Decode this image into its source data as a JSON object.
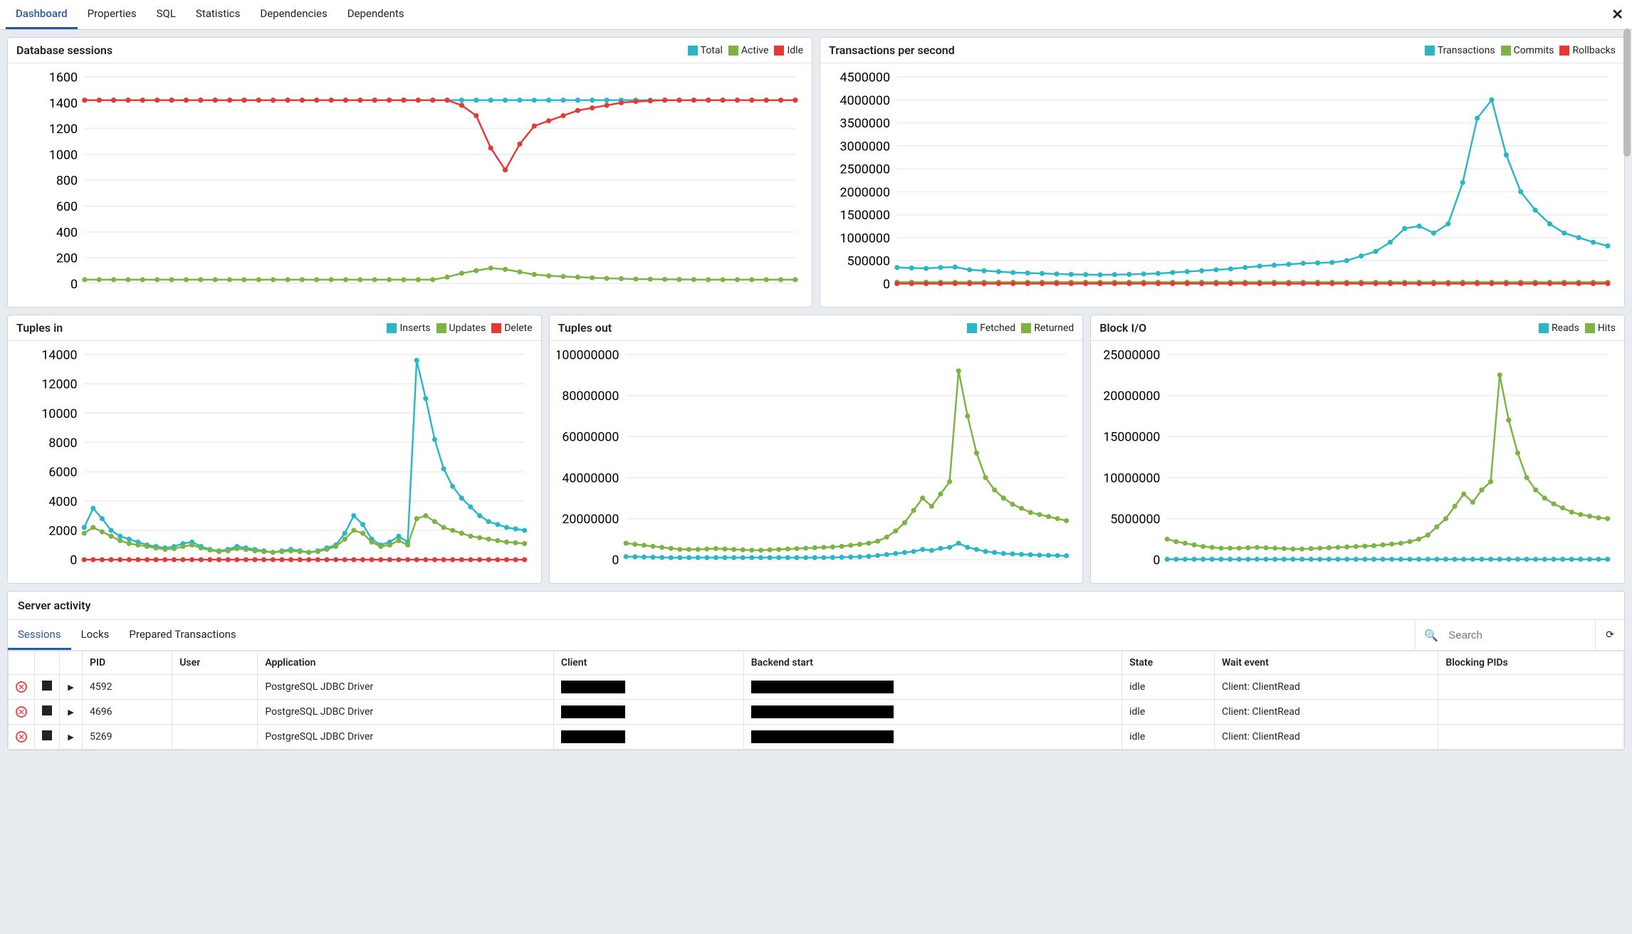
{
  "colors": {
    "cyan": "#29b6c6",
    "green": "#7cb342",
    "red": "#e53935"
  },
  "tabs": {
    "items": [
      "Dashboard",
      "Properties",
      "SQL",
      "Statistics",
      "Dependencies",
      "Dependents"
    ],
    "active": 0
  },
  "panels": {
    "db_sessions": {
      "title": "Database sessions",
      "legend": [
        "Total",
        "Active",
        "Idle"
      ]
    },
    "tps": {
      "title": "Transactions per second",
      "legend": [
        "Transactions",
        "Commits",
        "Rollbacks"
      ]
    },
    "tuples_in": {
      "title": "Tuples in",
      "legend": [
        "Inserts",
        "Updates",
        "Delete"
      ]
    },
    "tuples_out": {
      "title": "Tuples out",
      "legend": [
        "Fetched",
        "Returned"
      ]
    },
    "block_io": {
      "title": "Block I/O",
      "legend": [
        "Reads",
        "Hits"
      ]
    }
  },
  "server_activity": {
    "title": "Server activity",
    "tabs": [
      "Sessions",
      "Locks",
      "Prepared Transactions"
    ],
    "active": 0,
    "search_placeholder": "Search",
    "columns": [
      "",
      "",
      "",
      "PID",
      "User",
      "Application",
      "Client",
      "Backend start",
      "State",
      "Wait event",
      "Blocking PIDs"
    ],
    "rows": [
      {
        "pid": "4592",
        "user": "",
        "app": "PostgreSQL JDBC Driver",
        "client": "[redacted]",
        "backend": "[redacted]",
        "state": "idle",
        "wait": "Client: ClientRead",
        "blocking": ""
      },
      {
        "pid": "4696",
        "user": "",
        "app": "PostgreSQL JDBC Driver",
        "client": "[redacted]",
        "backend": "[redacted]",
        "state": "idle",
        "wait": "Client: ClientRead",
        "blocking": ""
      },
      {
        "pid": "5269",
        "user": "",
        "app": "PostgreSQL JDBC Driver",
        "client": "[redacted]",
        "backend": "[redacted]",
        "state": "idle",
        "wait": "Client: ClientRead",
        "blocking": ""
      }
    ]
  },
  "chart_data": [
    {
      "id": "db_sessions",
      "type": "line",
      "title": "Database sessions",
      "ylim": [
        0,
        1600
      ],
      "yticks": [
        0,
        200,
        400,
        600,
        800,
        1000,
        1200,
        1400,
        1600
      ],
      "x_count": 50,
      "series": [
        {
          "name": "Total",
          "color": "cyan",
          "values": [
            1420,
            1420,
            1420,
            1420,
            1420,
            1420,
            1420,
            1420,
            1420,
            1420,
            1420,
            1420,
            1420,
            1420,
            1420,
            1420,
            1420,
            1420,
            1420,
            1420,
            1420,
            1420,
            1420,
            1420,
            1420,
            1420,
            1420,
            1420,
            1420,
            1420,
            1420,
            1420,
            1420,
            1420,
            1420,
            1420,
            1420,
            1420,
            1420,
            1420,
            1420,
            1420,
            1420,
            1420,
            1420,
            1420,
            1420,
            1420,
            1420,
            1420
          ]
        },
        {
          "name": "Idle",
          "color": "red",
          "values": [
            1420,
            1420,
            1420,
            1420,
            1420,
            1420,
            1420,
            1420,
            1420,
            1420,
            1420,
            1420,
            1420,
            1420,
            1420,
            1420,
            1420,
            1420,
            1420,
            1420,
            1420,
            1420,
            1420,
            1420,
            1420,
            1420,
            1380,
            1300,
            1050,
            880,
            1080,
            1220,
            1260,
            1300,
            1340,
            1360,
            1380,
            1400,
            1410,
            1415,
            1420,
            1420,
            1420,
            1420,
            1420,
            1420,
            1420,
            1420,
            1420,
            1420
          ]
        },
        {
          "name": "Active",
          "color": "green",
          "values": [
            30,
            30,
            30,
            30,
            30,
            30,
            30,
            30,
            30,
            30,
            30,
            30,
            30,
            30,
            30,
            30,
            30,
            30,
            30,
            30,
            30,
            30,
            30,
            30,
            30,
            50,
            80,
            100,
            120,
            110,
            90,
            70,
            60,
            55,
            50,
            45,
            40,
            38,
            35,
            34,
            33,
            32,
            31,
            30,
            30,
            30,
            30,
            30,
            30,
            30
          ]
        }
      ]
    },
    {
      "id": "tps",
      "type": "line",
      "title": "Transactions per second",
      "ylim": [
        0,
        4500000
      ],
      "yticks": [
        0,
        500000,
        1000000,
        1500000,
        2000000,
        2500000,
        3000000,
        3500000,
        4000000,
        4500000
      ],
      "x_count": 50,
      "series": [
        {
          "name": "Transactions",
          "color": "cyan",
          "values": [
            350000,
            340000,
            330000,
            350000,
            360000,
            300000,
            280000,
            260000,
            240000,
            230000,
            220000,
            210000,
            200000,
            195000,
            190000,
            195000,
            200000,
            210000,
            220000,
            240000,
            260000,
            280000,
            300000,
            320000,
            350000,
            380000,
            400000,
            420000,
            440000,
            450000,
            460000,
            500000,
            600000,
            700000,
            900000,
            1200000,
            1250000,
            1100000,
            1300000,
            2200000,
            3600000,
            4000000,
            2800000,
            2000000,
            1600000,
            1300000,
            1100000,
            1000000,
            900000,
            820000
          ]
        },
        {
          "name": "Commits",
          "color": "green",
          "values": [
            30000,
            30000,
            30000,
            30000,
            30000,
            30000,
            30000,
            30000,
            30000,
            30000,
            30000,
            30000,
            30000,
            30000,
            30000,
            30000,
            30000,
            30000,
            30000,
            30000,
            30000,
            30000,
            30000,
            30000,
            30000,
            30000,
            30000,
            30000,
            30000,
            30000,
            30000,
            30000,
            30000,
            30000,
            30000,
            30000,
            30000,
            30000,
            30000,
            30000,
            30000,
            30000,
            30000,
            30000,
            30000,
            30000,
            30000,
            30000,
            30000,
            30000
          ]
        },
        {
          "name": "Rollbacks",
          "color": "red",
          "values": [
            0,
            0,
            0,
            0,
            0,
            0,
            0,
            0,
            0,
            0,
            0,
            0,
            0,
            0,
            0,
            0,
            0,
            0,
            0,
            0,
            0,
            0,
            0,
            0,
            0,
            0,
            0,
            0,
            0,
            0,
            0,
            0,
            0,
            0,
            0,
            0,
            0,
            0,
            0,
            0,
            0,
            0,
            0,
            0,
            0,
            0,
            0,
            0,
            0,
            0
          ]
        }
      ]
    },
    {
      "id": "tuples_in",
      "type": "line",
      "title": "Tuples in",
      "ylim": [
        0,
        14000
      ],
      "yticks": [
        0,
        2000,
        4000,
        6000,
        8000,
        10000,
        12000,
        14000
      ],
      "x_count": 50,
      "series": [
        {
          "name": "Inserts",
          "color": "cyan",
          "values": [
            2200,
            3500,
            2800,
            2000,
            1600,
            1400,
            1200,
            1000,
            900,
            800,
            900,
            1100,
            1200,
            900,
            700,
            600,
            700,
            900,
            800,
            700,
            600,
            500,
            600,
            700,
            600,
            500,
            600,
            800,
            1000,
            1800,
            3000,
            2400,
            1400,
            1000,
            1200,
            1600,
            1200,
            13600,
            11000,
            8200,
            6200,
            5000,
            4200,
            3600,
            3000,
            2600,
            2400,
            2200,
            2100,
            2000
          ]
        },
        {
          "name": "Updates",
          "color": "green",
          "values": [
            1800,
            2200,
            1900,
            1600,
            1300,
            1100,
            1000,
            900,
            800,
            700,
            750,
            900,
            1000,
            800,
            650,
            550,
            600,
            750,
            700,
            600,
            550,
            500,
            550,
            600,
            550,
            500,
            550,
            700,
            900,
            1400,
            2000,
            1800,
            1200,
            900,
            1000,
            1300,
            1000,
            2800,
            3000,
            2600,
            2200,
            2000,
            1800,
            1600,
            1500,
            1400,
            1300,
            1200,
            1150,
            1100
          ]
        },
        {
          "name": "Delete",
          "color": "red",
          "values": [
            0,
            0,
            0,
            0,
            0,
            0,
            0,
            0,
            0,
            0,
            0,
            0,
            0,
            0,
            0,
            0,
            0,
            0,
            0,
            0,
            0,
            0,
            0,
            0,
            0,
            0,
            0,
            0,
            0,
            0,
            0,
            0,
            0,
            0,
            0,
            0,
            0,
            0,
            0,
            0,
            0,
            0,
            0,
            0,
            0,
            0,
            0,
            0,
            0,
            0
          ]
        }
      ]
    },
    {
      "id": "tuples_out",
      "type": "line",
      "title": "Tuples out",
      "ylim": [
        0,
        100000000
      ],
      "yticks": [
        0,
        20000000,
        40000000,
        60000000,
        80000000,
        100000000
      ],
      "x_count": 50,
      "series": [
        {
          "name": "Returned",
          "color": "green",
          "values": [
            8000000,
            7500000,
            7000000,
            6500000,
            6000000,
            5500000,
            5000000,
            5000000,
            5000000,
            5200000,
            5400000,
            5200000,
            5000000,
            4800000,
            4600000,
            4600000,
            4800000,
            5000000,
            5200000,
            5400000,
            5600000,
            5800000,
            6000000,
            6200000,
            6500000,
            7000000,
            7500000,
            8000000,
            9000000,
            11000000,
            14000000,
            18000000,
            24000000,
            30000000,
            26000000,
            32000000,
            38000000,
            92000000,
            70000000,
            52000000,
            40000000,
            34000000,
            30000000,
            27000000,
            25000000,
            23000000,
            22000000,
            21000000,
            20000000,
            19000000
          ]
        },
        {
          "name": "Fetched",
          "color": "cyan",
          "values": [
            1500000,
            1400000,
            1300000,
            1200000,
            1100000,
            1000000,
            1000000,
            1000000,
            1000000,
            1000000,
            1000000,
            1000000,
            1000000,
            1000000,
            1000000,
            1000000,
            1000000,
            1000000,
            1000000,
            1000000,
            1000000,
            1000000,
            1000000,
            1100000,
            1200000,
            1300000,
            1400000,
            1600000,
            2000000,
            2500000,
            3000000,
            3500000,
            4000000,
            5000000,
            4500000,
            5500000,
            6000000,
            8000000,
            6000000,
            5000000,
            4000000,
            3500000,
            3000000,
            2800000,
            2600000,
            2400000,
            2200000,
            2100000,
            2000000,
            1900000
          ]
        }
      ]
    },
    {
      "id": "block_io",
      "type": "line",
      "title": "Block I/O",
      "ylim": [
        0,
        25000000
      ],
      "yticks": [
        0,
        5000000,
        10000000,
        15000000,
        20000000,
        25000000
      ],
      "x_count": 50,
      "series": [
        {
          "name": "Hits",
          "color": "green",
          "values": [
            2500000,
            2200000,
            2000000,
            1800000,
            1600000,
            1500000,
            1400000,
            1400000,
            1400000,
            1450000,
            1500000,
            1450000,
            1400000,
            1350000,
            1300000,
            1300000,
            1350000,
            1400000,
            1450000,
            1500000,
            1550000,
            1600000,
            1650000,
            1700000,
            1800000,
            1900000,
            2000000,
            2200000,
            2500000,
            3000000,
            4000000,
            5000000,
            6500000,
            8000000,
            7000000,
            8500000,
            9500000,
            22500000,
            17000000,
            13000000,
            10000000,
            8500000,
            7500000,
            6800000,
            6300000,
            5800000,
            5500000,
            5300000,
            5100000,
            5000000
          ]
        },
        {
          "name": "Reads",
          "color": "cyan",
          "values": [
            50000,
            50000,
            50000,
            50000,
            50000,
            50000,
            50000,
            50000,
            50000,
            50000,
            50000,
            50000,
            50000,
            50000,
            50000,
            50000,
            50000,
            50000,
            50000,
            50000,
            50000,
            50000,
            50000,
            50000,
            50000,
            50000,
            50000,
            50000,
            50000,
            50000,
            50000,
            50000,
            50000,
            50000,
            50000,
            50000,
            50000,
            50000,
            50000,
            50000,
            50000,
            50000,
            50000,
            50000,
            50000,
            50000,
            50000,
            50000,
            50000,
            50000
          ]
        }
      ]
    }
  ]
}
